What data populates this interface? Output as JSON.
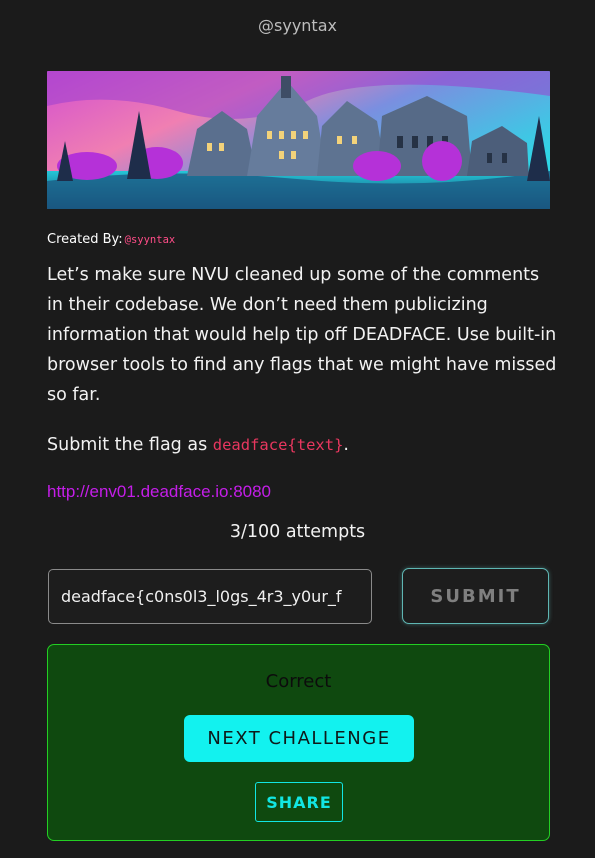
{
  "author_heading": "@syyntax",
  "banner": {
    "image": "haunted-mansion-neon-illustration"
  },
  "created_by": {
    "label": "Created By:",
    "handle": "@syyntax"
  },
  "description": "Let’s make sure NVU cleaned up some of the comments in their codebase. We don’t need them publicizing information that would help tip off DEADFACE. Use built-in browser tools to find any flags that we might have missed so far.",
  "submit_instructions": {
    "prefix": "Submit the flag as ",
    "format": "deadface{text}",
    "suffix": "."
  },
  "challenge_link": "http://env01.deadface.io:8080",
  "attempts": "3/100 attempts",
  "flag_input": {
    "value": "deadface{c0ns0l3_l0gs_4r3_y0ur_f"
  },
  "submit_button": "SUBMIT",
  "result": {
    "status": "Correct",
    "next_button": "NEXT CHALLENGE",
    "share_button": "SHARE"
  },
  "colors": {
    "background": "#1b1b1b",
    "link": "#c41ee8",
    "code": "#e8375f",
    "success_bg": "#0f490f",
    "success_border": "#23cf23",
    "accent_cyan": "#12f2ef"
  }
}
